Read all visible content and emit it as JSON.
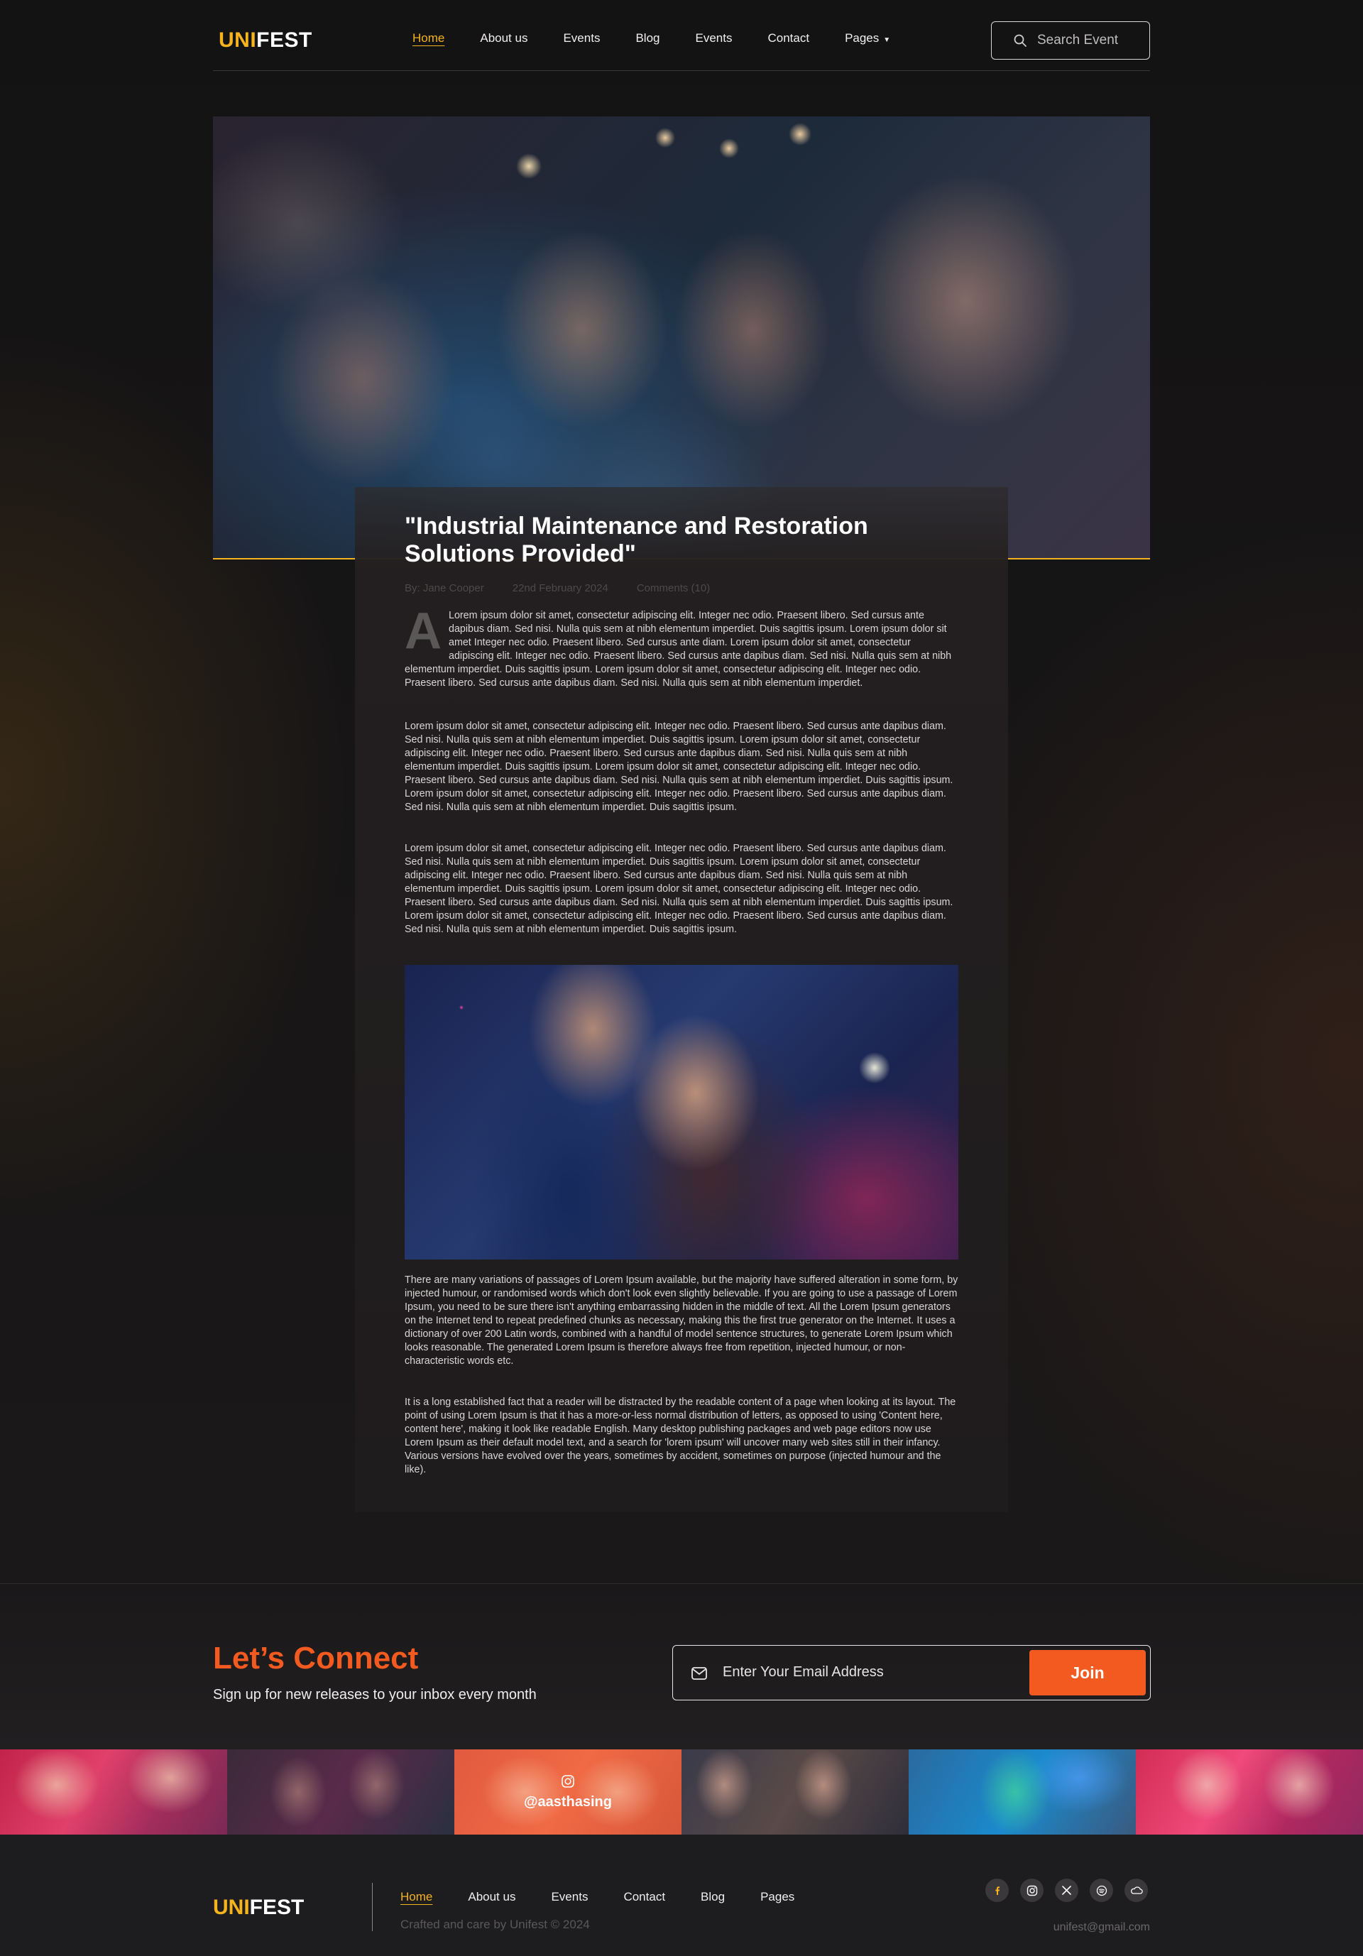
{
  "brand": {
    "logo_accent": "UNI",
    "logo_rest": "FEST"
  },
  "nav": {
    "items": [
      "Home",
      "About us",
      "Events",
      "Blog",
      "Events",
      "Contact",
      "Pages"
    ],
    "active": "Home"
  },
  "search": {
    "placeholder": "Search Event"
  },
  "article": {
    "title": "\"Industrial Maintenance and Restoration Solutions Provided\"",
    "author": "By: Jane Cooper",
    "date": "22nd February 2024",
    "comments": "Comments (10)",
    "dropcap": "A",
    "p1": "Lorem ipsum dolor sit amet, consectetur adipiscing elit. Integer nec odio. Praesent libero. Sed cursus ante dapibus diam. Sed nisi. Nulla quis sem at nibh elementum imperdiet. Duis sagittis ipsum. Lorem ipsum dolor sit amet Integer nec odio. Praesent libero. Sed cursus ante diam. Lorem ipsum dolor sit amet, consectetur adipiscing elit. Integer nec odio. Praesent libero. Sed cursus ante dapibus diam. Sed nisi. Nulla quis sem at nibh elementum imperdiet. Duis sagittis ipsum. Lorem ipsum dolor sit amet, consectetur adipiscing elit. Integer nec odio. Praesent libero. Sed cursus ante dapibus diam. Sed nisi. Nulla quis sem at nibh elementum imperdiet.",
    "p2": "Lorem ipsum dolor sit amet, consectetur adipiscing elit. Integer nec odio. Praesent libero. Sed cursus ante dapibus diam. Sed nisi. Nulla quis sem at nibh elementum imperdiet. Duis sagittis ipsum. Lorem ipsum dolor sit amet, consectetur adipiscing elit. Integer nec odio. Praesent libero. Sed cursus ante dapibus diam. Sed nisi. Nulla quis sem at nibh elementum imperdiet. Duis sagittis ipsum. Lorem ipsum dolor sit amet, consectetur adipiscing elit. Integer nec odio. Praesent libero. Sed cursus ante dapibus diam. Sed nisi. Nulla quis sem at nibh elementum imperdiet. Duis sagittis ipsum. Lorem ipsum dolor sit amet, consectetur adipiscing elit. Integer nec odio. Praesent libero. Sed cursus ante dapibus diam. Sed nisi. Nulla quis sem at nibh elementum imperdiet. Duis sagittis ipsum.",
    "p3": "Lorem ipsum dolor sit amet, consectetur adipiscing elit. Integer nec odio. Praesent libero. Sed cursus ante dapibus diam. Sed nisi. Nulla quis sem at nibh elementum imperdiet. Duis sagittis ipsum. Lorem ipsum dolor sit amet, consectetur adipiscing elit. Integer nec odio. Praesent libero. Sed cursus ante dapibus diam. Sed nisi. Nulla quis sem at nibh elementum imperdiet. Duis sagittis ipsum. Lorem ipsum dolor sit amet, consectetur adipiscing elit. Integer nec odio. Praesent libero. Sed cursus ante dapibus diam. Sed nisi. Nulla quis sem at nibh elementum imperdiet. Duis sagittis ipsum. Lorem ipsum dolor sit amet, consectetur adipiscing elit. Integer nec odio. Praesent libero. Sed cursus ante dapibus diam. Sed nisi. Nulla quis sem at nibh elementum imperdiet. Duis sagittis ipsum.",
    "p4": "There are many variations of passages of Lorem Ipsum available, but the majority have suffered alteration in some form, by injected humour, or randomised words which don't look even slightly believable. If you are going to use a passage of Lorem Ipsum, you need to be sure there isn't anything embarrassing hidden in the middle of text. All the Lorem Ipsum generators on the Internet tend to repeat predefined chunks as necessary, making this the first true generator on the Internet. It uses a dictionary of over 200 Latin words, combined with a handful of model sentence structures, to generate Lorem Ipsum which looks reasonable. The generated Lorem Ipsum is therefore always free from repetition, injected humour, or non-characteristic words etc.",
    "p5": "It is a long established fact that a reader will be distracted by the readable content of a page when looking at its layout. The point of using Lorem Ipsum is that it has a more-or-less normal distribution of letters, as opposed to using 'Content here, content here', making it look like readable English. Many desktop publishing packages and web page editors now use Lorem Ipsum as their default model text, and a search for 'lorem ipsum' will uncover many web sites still in their infancy. Various versions have evolved over the years, sometimes by accident, sometimes on purpose (injected humour and the like)."
  },
  "connect": {
    "title": "Let’s Connect",
    "subtitle": "Sign up for new releases to your inbox every month",
    "email_placeholder": "Enter Your Email Address",
    "join_label": "Join"
  },
  "gallery": {
    "instagram_handle": "@aasthasing"
  },
  "footer": {
    "nav": [
      "Home",
      "About us",
      "Events",
      "Contact",
      "Blog",
      "Pages"
    ],
    "copyright": "Crafted and care by Unifest © 2024",
    "email": "unifest@gmail.com",
    "socials": [
      "facebook-icon",
      "instagram-icon",
      "x-icon",
      "spotify-icon",
      "soundcloud-icon"
    ]
  },
  "colors": {
    "accent_yellow": "#f5b31d",
    "accent_orange": "#f25a1f",
    "background": "#141314"
  }
}
